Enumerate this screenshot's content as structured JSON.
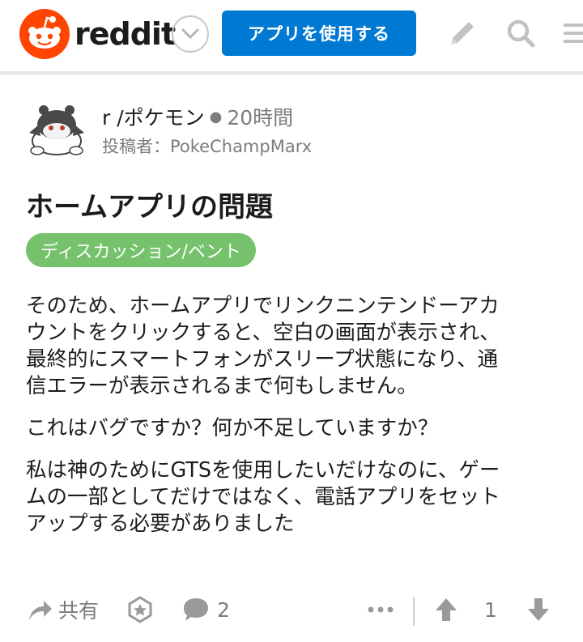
{
  "header": {
    "brand": "reddit",
    "app_button_label": "アプリを使用する",
    "icons": [
      "snoo-logo-icon",
      "chevron-down-icon",
      "pencil-icon",
      "search-icon",
      "menu-icon"
    ]
  },
  "post": {
    "subreddit": "r /ポケモン",
    "time_ago": "20時間",
    "author_line": "投稿者：PokeChampMarx",
    "title": "ホームアプリの問題",
    "flair": "ディスカッション/ベント",
    "paragraphs": [
      "そのため、ホームアプリでリンクニンテンドーアカ\nウントをクリックすると、空白の画面が表示され、\n最終的にスマートフォンがスリープ状態になり、通\n信エラーが表示されるまで何もしません。",
      "これはバグですか？何か不足していますか？",
      "私は神のためにGTSを使用したいだけなのに、ゲー\nムの一部としてだけではなく、電話アプリをセット\nアップする必要がありました"
    ]
  },
  "actions": {
    "share_label": "共有",
    "comment_count": "2",
    "vote_count": "1",
    "icons": [
      "share-icon",
      "award-icon",
      "comment-icon",
      "more-icon",
      "upvote-icon",
      "downvote-icon"
    ]
  },
  "colors": {
    "brand_orange": "#ff4500",
    "primary_blue": "#0079d3",
    "flair_green": "#76c26c",
    "muted_gray": "#7c7c7c"
  }
}
